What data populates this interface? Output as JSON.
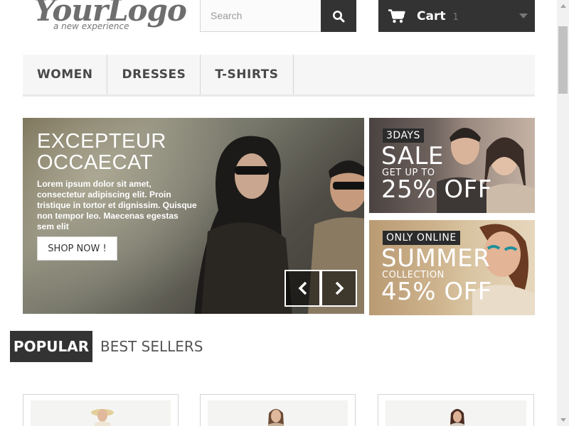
{
  "header": {
    "logo": {
      "main": "YourLogo",
      "tagline": "a new experience"
    },
    "search": {
      "placeholder": "Search",
      "icon": "search-icon"
    },
    "cart": {
      "label": "Cart",
      "count": "1",
      "icon": "cart-icon"
    }
  },
  "nav": {
    "items": [
      {
        "label": "WOMEN"
      },
      {
        "label": "DRESSES"
      },
      {
        "label": "T-SHIRTS"
      }
    ]
  },
  "slider": {
    "title_line1": "EXCEPTEUR",
    "title_line2": "OCCAECAT",
    "description": "Lorem ipsum dolor sit amet, consectetur adipiscing elit. Proin tristique in tortor et dignissim. Quisque non tempor leo. Maecenas egestas sem elit",
    "button_label": "SHOP NOW !",
    "prev_icon": "chevron-left-icon",
    "next_icon": "chevron-right-icon"
  },
  "banners": [
    {
      "tag": "3DAYS",
      "big": "SALE",
      "small": "GET UP TO",
      "offer": "25% OFF"
    },
    {
      "tag": "ONLY ONLINE",
      "big": "SUMMER",
      "small": "COLLECTION",
      "offer": "45% OFF"
    }
  ],
  "tabs": {
    "popular": "POPULAR",
    "best_sellers": "BEST SELLERS"
  },
  "colors": {
    "dark": "#333333",
    "nav_bg": "#f6f6f6",
    "border": "#d6d4d4"
  }
}
